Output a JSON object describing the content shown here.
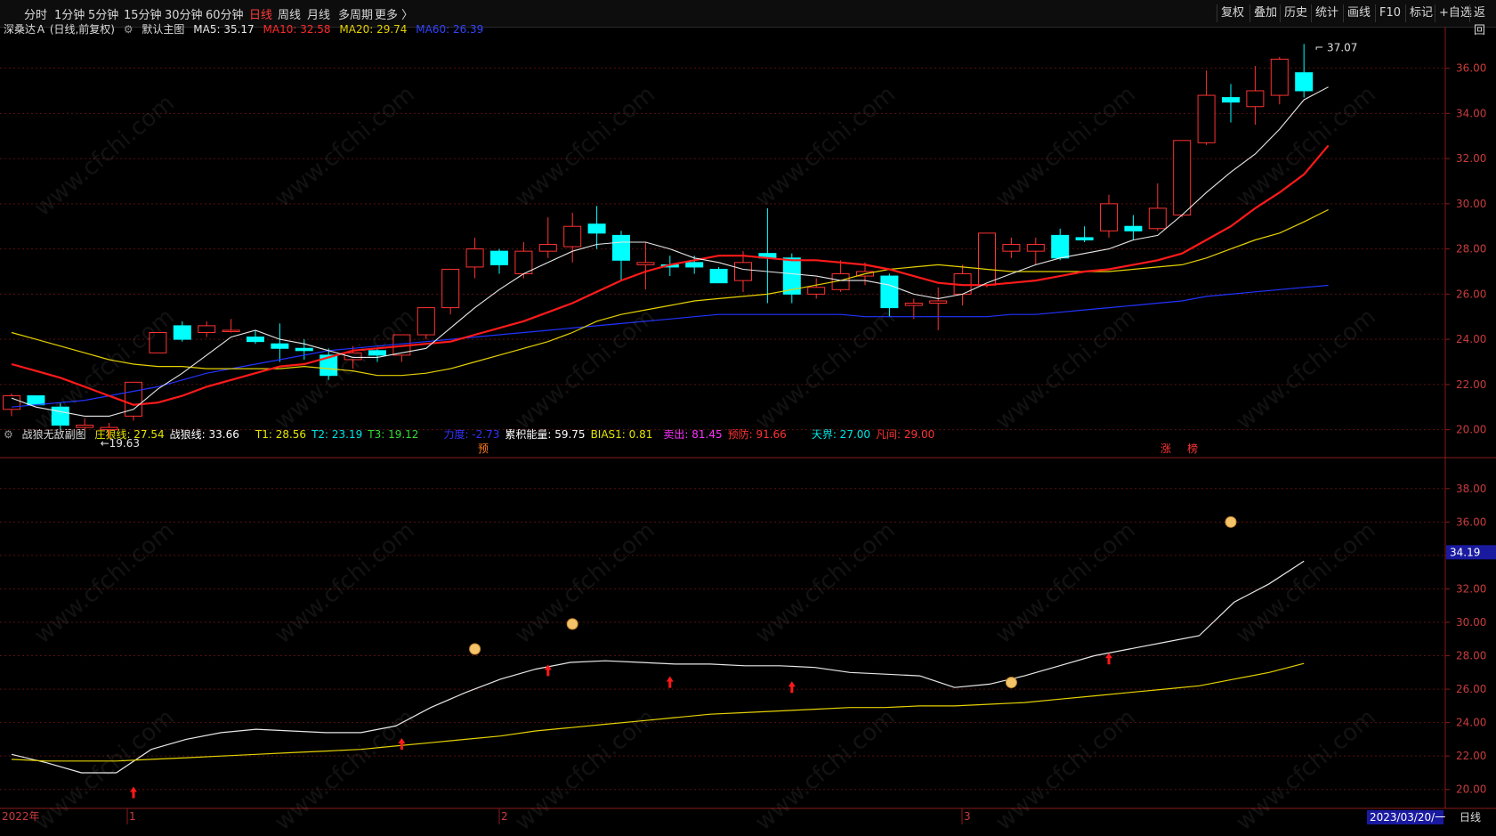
{
  "toolbar": {
    "periods": [
      {
        "label": "分时",
        "active": false
      },
      {
        "label": "1分钟",
        "active": false
      },
      {
        "label": "5分钟",
        "active": false
      },
      {
        "label": "15分钟",
        "active": false
      },
      {
        "label": "30分钟",
        "active": false
      },
      {
        "label": "60分钟",
        "active": false
      },
      {
        "label": "日线",
        "active": true
      },
      {
        "label": "周线",
        "active": false
      },
      {
        "label": "月线",
        "active": false
      },
      {
        "label": "多周期",
        "active": false
      },
      {
        "label": "更多 〉",
        "active": false
      }
    ],
    "right": [
      "复权",
      "叠加",
      "历史",
      "统计",
      "画线",
      "F10",
      "标记",
      "+自选",
      "返回"
    ]
  },
  "main_info": {
    "stock": "深桑达Ａ (日线,前复权)",
    "chart_name": "默认主图",
    "ma5": "MA5: 35.17",
    "ma10": "MA10: 32.58",
    "ma20": "MA20: 29.74",
    "ma60": "MA60: 26.39"
  },
  "sub_info": {
    "name": "战狼无敌副图",
    "items": [
      {
        "text": "庄狼线: 27.54",
        "color": "#e6e600"
      },
      {
        "text": "战狼线: 33.66",
        "color": "#ffffff"
      },
      {
        "text": "T1: 28.56",
        "color": "#e6e600"
      },
      {
        "text": "T2: 23.19",
        "color": "#00e6e6"
      },
      {
        "text": "T3: 19.12",
        "color": "#33dd33"
      },
      {
        "text": "力度: -2.73",
        "color": "#3333ff"
      },
      {
        "text": "累积能量: 59.75",
        "color": "#ffffff"
      },
      {
        "text": "BIAS1: 0.81",
        "color": "#e6e600"
      },
      {
        "text": "卖出: 81.45",
        "color": "#ff33ff"
      },
      {
        "text": "预防: 91.66",
        "color": "#ff3333"
      },
      {
        "text": "天界: 27.00",
        "color": "#00e6e6"
      },
      {
        "text": "凡间: 29.00",
        "color": "#ff3333"
      }
    ]
  },
  "bottom": {
    "year_label": "2022年",
    "month_labels": [
      "1",
      "2",
      "3"
    ],
    "date_label": "2023/03/20/一",
    "period_label": "日线"
  },
  "price_labels": {
    "high": "37.07",
    "low": "19.63",
    "sub_current": "34.19"
  },
  "badges": [
    "预",
    "涨",
    "榜"
  ],
  "watermark": "www.cfchi.com",
  "chart_data": [
    {
      "type": "candlestick",
      "yticks": [
        "36.00",
        "34.00",
        "32.00",
        "30.00",
        "28.00",
        "26.00",
        "24.00",
        "22.00",
        "20.00"
      ],
      "ylim": [
        19.0,
        37.6
      ],
      "colors": {
        "up": "#ff3232",
        "down": "#00ffff",
        "ma5": "#e8e8e8",
        "ma10": "#ff1a1a",
        "ma20": "#e6d200",
        "ma60": "#2233ff"
      },
      "candles": [
        [
          20.9,
          21.6,
          20.6,
          21.5
        ],
        [
          21.5,
          21.5,
          21.1,
          21.1
        ],
        [
          21.0,
          21.2,
          20.0,
          20.2
        ],
        [
          20.1,
          20.5,
          20.0,
          20.2
        ],
        [
          20.0,
          20.3,
          19.63,
          20.1
        ],
        [
          20.6,
          22.1,
          20.4,
          22.1
        ],
        [
          23.4,
          24.3,
          23.4,
          24.3
        ],
        [
          24.6,
          24.8,
          23.9,
          24.0
        ],
        [
          24.3,
          24.8,
          24.1,
          24.6
        ],
        [
          24.4,
          24.9,
          24.3,
          24.4
        ],
        [
          24.1,
          24.4,
          23.8,
          23.9
        ],
        [
          23.8,
          24.7,
          23.0,
          23.6
        ],
        [
          23.6,
          24.0,
          23.1,
          23.5
        ],
        [
          23.3,
          23.6,
          22.2,
          22.4
        ],
        [
          23.1,
          23.7,
          22.7,
          23.4
        ],
        [
          23.5,
          23.6,
          23.0,
          23.3
        ],
        [
          23.3,
          24.1,
          23.0,
          24.2
        ],
        [
          24.2,
          25.4,
          24.0,
          25.4
        ],
        [
          25.4,
          27.1,
          25.1,
          27.1
        ],
        [
          27.2,
          28.5,
          26.7,
          28.0
        ],
        [
          27.9,
          28.0,
          26.9,
          27.3
        ],
        [
          26.9,
          28.3,
          26.7,
          27.9
        ],
        [
          27.9,
          29.4,
          27.6,
          28.2
        ],
        [
          28.1,
          29.6,
          27.4,
          29.0
        ],
        [
          29.1,
          29.9,
          28.0,
          28.7
        ],
        [
          28.6,
          28.8,
          26.6,
          27.5
        ],
        [
          27.3,
          28.3,
          26.2,
          27.4
        ],
        [
          27.3,
          27.7,
          26.8,
          27.2
        ],
        [
          27.4,
          27.7,
          26.9,
          27.2
        ],
        [
          27.1,
          27.2,
          26.5,
          26.5
        ],
        [
          26.6,
          27.9,
          26.1,
          27.4
        ],
        [
          27.8,
          29.8,
          25.6,
          27.6
        ],
        [
          27.6,
          27.8,
          25.6,
          26.0
        ],
        [
          26.0,
          26.7,
          25.8,
          26.3
        ],
        [
          26.2,
          27.5,
          26.1,
          26.9
        ],
        [
          26.8,
          27.4,
          26.4,
          27.0
        ],
        [
          26.8,
          26.9,
          25.0,
          25.4
        ],
        [
          25.5,
          25.8,
          24.9,
          25.6
        ],
        [
          25.6,
          26.3,
          24.4,
          25.7
        ],
        [
          26.0,
          27.3,
          25.5,
          26.9
        ],
        [
          26.4,
          28.7,
          26.3,
          28.7
        ],
        [
          27.9,
          28.5,
          27.6,
          28.2
        ],
        [
          27.9,
          28.5,
          27.3,
          28.2
        ],
        [
          28.6,
          28.9,
          27.5,
          27.6
        ],
        [
          28.5,
          29.0,
          28.3,
          28.4
        ],
        [
          28.8,
          30.4,
          28.5,
          30.0
        ],
        [
          29.0,
          29.5,
          28.4,
          28.8
        ],
        [
          28.9,
          30.9,
          28.8,
          29.8
        ],
        [
          29.5,
          30.8,
          29.4,
          32.8
        ],
        [
          32.7,
          35.9,
          32.6,
          34.8
        ],
        [
          34.7,
          35.3,
          33.6,
          34.5
        ],
        [
          34.3,
          36.1,
          33.5,
          35.0
        ],
        [
          34.8,
          36.5,
          34.4,
          36.4
        ],
        [
          35.8,
          37.07,
          34.7,
          35.0
        ]
      ],
      "ma5": [
        21.4,
        21.0,
        20.8,
        20.6,
        20.6,
        20.9,
        21.8,
        22.5,
        23.3,
        24.1,
        24.4,
        24.0,
        23.8,
        23.5,
        23.2,
        23.2,
        23.4,
        23.6,
        24.5,
        25.4,
        26.2,
        26.9,
        27.4,
        27.9,
        28.2,
        28.3,
        28.3,
        28.0,
        27.6,
        27.4,
        27.1,
        27.0,
        26.9,
        26.8,
        26.6,
        26.6,
        26.4,
        26.0,
        25.8,
        26.0,
        26.5,
        26.9,
        27.3,
        27.6,
        27.8,
        28.0,
        28.4,
        28.6,
        29.5,
        30.5,
        31.4,
        32.2,
        33.3,
        34.6,
        35.17
      ],
      "ma10": [
        22.9,
        22.6,
        22.3,
        21.9,
        21.5,
        21.1,
        21.2,
        21.5,
        21.9,
        22.2,
        22.5,
        22.8,
        22.9,
        23.2,
        23.5,
        23.6,
        23.7,
        23.8,
        23.9,
        24.2,
        24.5,
        24.8,
        25.2,
        25.6,
        26.1,
        26.6,
        27.0,
        27.3,
        27.5,
        27.7,
        27.7,
        27.6,
        27.5,
        27.5,
        27.4,
        27.3,
        27.1,
        26.8,
        26.5,
        26.4,
        26.4,
        26.5,
        26.6,
        26.8,
        27.0,
        27.1,
        27.3,
        27.5,
        27.8,
        28.4,
        29.0,
        29.8,
        30.5,
        31.3,
        32.58
      ],
      "ma20": [
        24.3,
        24.0,
        23.7,
        23.4,
        23.1,
        22.9,
        22.8,
        22.8,
        22.7,
        22.7,
        22.7,
        22.7,
        22.8,
        22.7,
        22.6,
        22.4,
        22.4,
        22.5,
        22.7,
        23.0,
        23.3,
        23.6,
        23.9,
        24.3,
        24.8,
        25.1,
        25.3,
        25.5,
        25.7,
        25.8,
        25.9,
        26.0,
        26.2,
        26.4,
        26.6,
        26.9,
        27.1,
        27.2,
        27.3,
        27.2,
        27.1,
        27.0,
        27.0,
        27.0,
        27.0,
        27.0,
        27.1,
        27.2,
        27.3,
        27.6,
        28.0,
        28.4,
        28.7,
        29.2,
        29.74
      ],
      "ma60": [
        21.0,
        21.1,
        21.2,
        21.3,
        21.5,
        21.7,
        21.9,
        22.2,
        22.5,
        22.7,
        22.9,
        23.1,
        23.3,
        23.5,
        23.6,
        23.7,
        23.8,
        23.9,
        24.0,
        24.1,
        24.2,
        24.3,
        24.4,
        24.5,
        24.6,
        24.7,
        24.8,
        24.9,
        25.0,
        25.1,
        25.1,
        25.1,
        25.1,
        25.1,
        25.1,
        25.0,
        25.0,
        25.0,
        25.0,
        25.0,
        25.0,
        25.1,
        25.1,
        25.2,
        25.3,
        25.4,
        25.5,
        25.6,
        25.7,
        25.9,
        26.0,
        26.1,
        26.2,
        26.3,
        26.39
      ]
    },
    {
      "type": "line",
      "yticks": [
        "38.00",
        "36.00",
        "34.00",
        "32.00",
        "30.00",
        "28.00",
        "26.00",
        "24.00",
        "22.00",
        "20.00"
      ],
      "ylim": [
        19.4,
        39.0
      ],
      "series": [
        {
          "name": "战狼线",
          "color": "#e8e8e8",
          "values": [
            22.1,
            21.6,
            21.0,
            21.0,
            22.4,
            23.0,
            23.4,
            23.6,
            23.5,
            23.4,
            23.4,
            23.8,
            24.9,
            25.8,
            26.6,
            27.2,
            27.6,
            27.7,
            27.6,
            27.5,
            27.5,
            27.4,
            27.4,
            27.3,
            27.0,
            26.9,
            26.8,
            26.1,
            26.3,
            26.8,
            27.4,
            28.0,
            28.4,
            28.8,
            29.2,
            31.2,
            32.3,
            33.66
          ]
        },
        {
          "name": "庄狼线",
          "color": "#e6d200",
          "values": [
            21.8,
            21.7,
            21.7,
            21.7,
            21.8,
            21.9,
            22.0,
            22.1,
            22.2,
            22.3,
            22.4,
            22.6,
            22.8,
            23.0,
            23.2,
            23.5,
            23.7,
            23.9,
            24.1,
            24.3,
            24.5,
            24.6,
            24.7,
            24.8,
            24.9,
            24.9,
            25.0,
            25.0,
            25.1,
            25.2,
            25.4,
            25.6,
            25.8,
            26.0,
            26.2,
            26.6,
            27.0,
            27.54
          ]
        }
      ],
      "signals": [
        {
          "type": "up-arrow",
          "bar": 5,
          "value": 19.8
        },
        {
          "type": "up-arrow",
          "bar": 16,
          "value": 22.7
        },
        {
          "type": "up-arrow",
          "bar": 22,
          "value": 27.1
        },
        {
          "type": "up-arrow",
          "bar": 27,
          "value": 26.4
        },
        {
          "type": "up-arrow",
          "bar": 32,
          "value": 26.1
        },
        {
          "type": "up-arrow",
          "bar": 45,
          "value": 27.8
        },
        {
          "type": "marker",
          "bar": 19,
          "value": 28.4
        },
        {
          "type": "marker",
          "bar": 23,
          "value": 29.9
        },
        {
          "type": "marker",
          "bar": 41,
          "value": 26.4
        },
        {
          "type": "marker",
          "bar": 50,
          "value": 36.0
        }
      ]
    }
  ]
}
